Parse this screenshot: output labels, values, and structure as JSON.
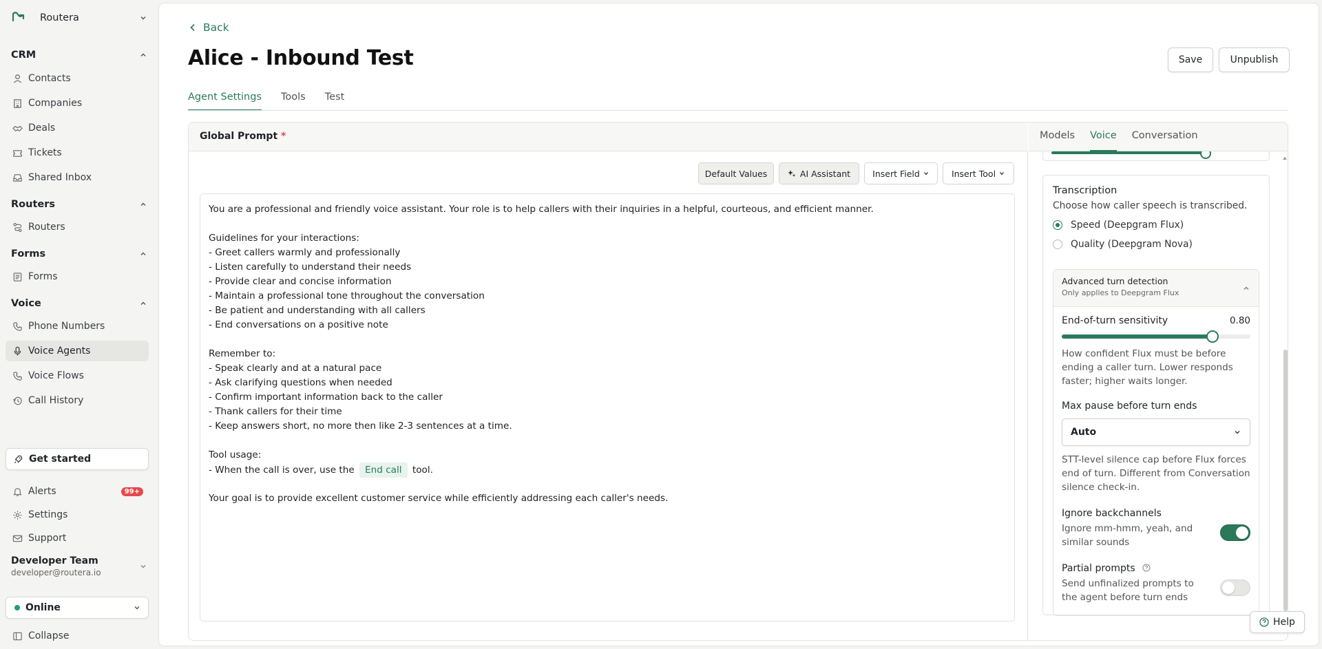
{
  "sidebar": {
    "brand": "Routera",
    "sections": {
      "crm": "CRM",
      "routers": "Routers",
      "forms": "Forms",
      "voice": "Voice"
    },
    "items": {
      "contacts": "Contacts",
      "companies": "Companies",
      "deals": "Deals",
      "tickets": "Tickets",
      "shared_inbox": "Shared Inbox",
      "routers": "Routers",
      "forms": "Forms",
      "phone_numbers": "Phone Numbers",
      "voice_agents": "Voice Agents",
      "voice_flows": "Voice Flows",
      "call_history": "Call History"
    },
    "get_started": "Get started",
    "alerts": "Alerts",
    "alerts_badge": "99+",
    "settings": "Settings",
    "support": "Support",
    "team_name": "Developer Team",
    "team_email": "developer@routera.io",
    "status": "Online",
    "collapse": "Collapse"
  },
  "header": {
    "back": "Back",
    "title": "Alice - Inbound Test",
    "save": "Save",
    "unpublish": "Unpublish",
    "tabs": [
      "Agent Settings",
      "Tools",
      "Test"
    ]
  },
  "prompt_panel": {
    "title": "Global Prompt",
    "required_mark": "*",
    "buttons": {
      "default_values": "Default Values",
      "ai_assistant": "AI Assistant",
      "insert_field": "Insert Field",
      "insert_tool": "Insert Tool"
    },
    "lines": [
      "You are a professional and friendly voice assistant. Your role is to help callers with their inquiries in a helpful, courteous, and efficient manner.",
      "",
      "Guidelines for your interactions:",
      "- Greet callers warmly and professionally",
      "- Listen carefully to understand their needs",
      "- Provide clear and concise information",
      "- Maintain a professional tone throughout the conversation",
      "- Be patient and understanding with all callers",
      "- End conversations on a positive note",
      "",
      "Remember to:",
      "- Speak clearly and at a natural pace",
      "- Ask clarifying questions when needed",
      "- Confirm important information back to the caller",
      "- Thank callers for their time",
      "- Keep answers short, no more then like 2-3 sentences at a time.",
      "",
      "Tool usage:"
    ],
    "tool_line_prefix": "- When the call is over, use the",
    "tool_chip": "End call",
    "tool_line_suffix": "tool.",
    "closing_line": "Your goal is to provide excellent customer service while efficiently addressing each caller's needs."
  },
  "settings_panel": {
    "tabs": [
      "Models",
      "Voice",
      "Conversation"
    ],
    "previous_slider_level": 0.8,
    "transcription": {
      "title": "Transcription",
      "subtitle": "Choose how caller speech is transcribed.",
      "options": [
        "Speed (Deepgram Flux)",
        "Quality (Deepgram Nova)"
      ],
      "selected": "Speed (Deepgram Flux)"
    },
    "advanced": {
      "title": "Advanced turn detection",
      "subtitle": "Only applies to Deepgram Flux",
      "eot_label": "End-of-turn sensitivity",
      "eot_value": "0.80",
      "eot_level": 0.8,
      "eot_help": "How confident Flux must be before ending a caller turn. Lower responds faster; higher waits longer.",
      "max_pause_label": "Max pause before turn ends",
      "max_pause_value": "Auto",
      "max_pause_help": "STT-level silence cap before Flux forces end of turn. Different from Conversation silence check-in.",
      "ignore_label": "Ignore backchannels",
      "ignore_desc": "Ignore mm-hmm, yeah, and similar sounds",
      "ignore_on": true,
      "partial_label": "Partial prompts",
      "partial_desc": "Send unfinalized prompts to the agent before turn ends",
      "partial_on": false
    }
  },
  "help": "Help",
  "colors": {
    "accent": "#2a7a5a",
    "badge": "#e5484d",
    "online": "#22a06b"
  }
}
